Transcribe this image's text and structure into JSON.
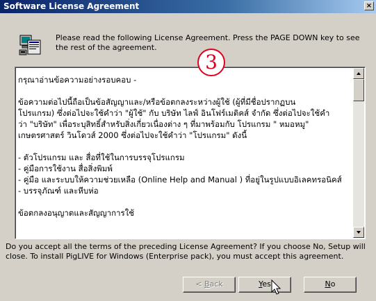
{
  "window": {
    "title": "Software License Agreement",
    "close_glyph": "×"
  },
  "intro": {
    "text": "Please read the following License Agreement.  Press the PAGE DOWN key to see the rest of the agreement.",
    "icon": "setup-computer-icon"
  },
  "badge": {
    "number": "3"
  },
  "license": {
    "lines": [
      "กรุณาอ่านข้อความอย่างรอบคอบ -",
      "",
      "   ข้อความต่อไปนี้ถือเป็นข้อสัญญาและ/หรือข้อตกลงระหว่างผู้ใช้ (ผู้ที่มีชื่อปรากฏบน",
      "โปรแกรม) ซึ่งต่อไปจะใช้คำว่า \"ผู้ใช้\" กับ บริษัท ไลฟ์ อินโฟร์เมติคส์ จำกัด ซึ่งต่อไปจะใช้คำ",
      "ว่า \"บริษัท\" เพื่อระบุสิทธิ์สำหรับสิ่งเกี่ยวเนื่องต่าง ๆ ที่มาพร้อมกับ โปรแกรม \" หมอหมู\"",
      "เกษตรศาสตร์ วินโดวส์ 2000 ซึ่งต่อไปจะใช้คำว่า \"โปรแกรม\" ดังนี้",
      "",
      "- ตัวโปรแกรม และ สื่อที่ใช้ในการบรรจุโปรแกรม",
      "- คู่มือการใช้งาน สื่อสิ่งพิมพ์",
      "- คู่มือ และระบบให้ความช่วยเหลือ (Online Help and Manual ) ที่อยู่ในรูปแบบอิเลคทรอนิคส์",
      "- บรรจุภัณฑ์ และหีบห่อ",
      "",
      "ข้อตกลงอนุญาตและสัญญาการใช้"
    ]
  },
  "question": {
    "text": "Do you accept all the terms of the preceding License Agreement?  If you choose No,  Setup will close.  To install PigLIVE for Windows (Enterprise pack), you must accept this agreement."
  },
  "buttons": {
    "back_prefix": "< ",
    "back_key": "B",
    "back_rest": "ack",
    "yes_key": "Y",
    "yes_rest": "es",
    "no_key": "N",
    "no_rest": "o"
  },
  "colors": {
    "dialog_bg": "#d4d0c8",
    "title_start": "#0a246a",
    "title_end": "#a6caf0",
    "badge_red": "#e0001a"
  }
}
